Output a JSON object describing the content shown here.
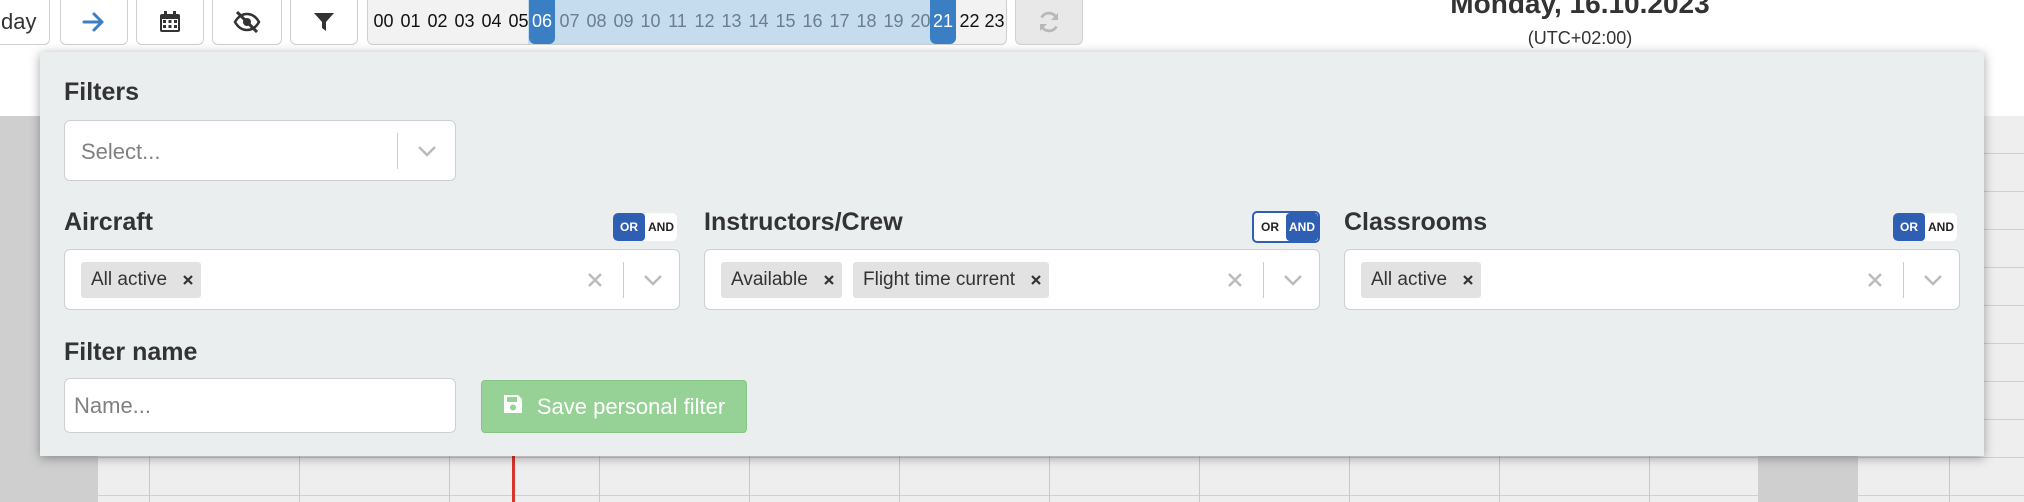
{
  "toolbar": {
    "today_label": "day",
    "hours": [
      "00",
      "01",
      "02",
      "03",
      "04",
      "05",
      "06",
      "07",
      "08",
      "09",
      "10",
      "11",
      "12",
      "13",
      "14",
      "15",
      "16",
      "17",
      "18",
      "19",
      "20",
      "21",
      "22",
      "23"
    ],
    "selected_hour_start": "06",
    "selected_hour_end": "21",
    "icons": [
      "arrow-right-icon",
      "calendar-icon",
      "eye-slash-icon",
      "filter-icon",
      "refresh-icon"
    ]
  },
  "header": {
    "date": "Monday, 16.10.2023",
    "timezone": "(UTC+02:00)"
  },
  "filter_panel": {
    "filters": {
      "label": "Filters",
      "placeholder": "Select..."
    },
    "aircraft": {
      "label": "Aircraft",
      "or": "OR",
      "and": "AND",
      "mode": "OR",
      "chips": [
        "All active"
      ]
    },
    "instructors": {
      "label": "Instructors/Crew",
      "or": "OR",
      "and": "AND",
      "mode": "AND",
      "chips": [
        "Available",
        "Flight time current"
      ]
    },
    "classrooms": {
      "label": "Classrooms",
      "or": "OR",
      "and": "AND",
      "mode": "OR",
      "chips": [
        "All active"
      ]
    },
    "filter_name": {
      "label": "Filter name",
      "placeholder": "Name..."
    },
    "save_button": "Save personal filter"
  },
  "colors": {
    "accent": "#2f5fb3",
    "hour_range": "#c5dcee",
    "hour_handle": "#3a7fc4",
    "save_button": "#96d296",
    "now_line": "#d9362b"
  }
}
